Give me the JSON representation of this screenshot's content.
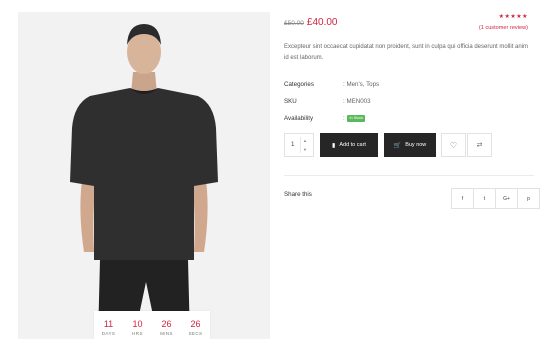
{
  "product": {
    "image_alt": "black oversized t-shirt model",
    "countdown": [
      {
        "num": "11",
        "label": "DAYS"
      },
      {
        "num": "10",
        "label": "HRS"
      },
      {
        "num": "26",
        "label": "MINS"
      },
      {
        "num": "26",
        "label": "SECS"
      }
    ]
  },
  "price": {
    "old": "£50.00",
    "new": "£40.00"
  },
  "rating": {
    "stars": "★★★★★",
    "review_text": "(1 customer review)"
  },
  "description": "Excepteur sint occaecat cupidatat non proident, sunt in culpa qui officia deserunt mollit anim id est laborum.",
  "meta": {
    "categories_label": "Categories",
    "categories_value": ": Men's, Tops",
    "sku_label": "SKU",
    "sku_value": ": MEN003",
    "availability_label": "Availability",
    "availability_prefix": ":",
    "availability_badge": "In Stock"
  },
  "cart": {
    "quantity": "1",
    "add_to_cart": "Add to cart",
    "buy_now": "Buy now"
  },
  "share": {
    "label": "Share this",
    "facebook": "f",
    "twitter": "t",
    "google": "G+",
    "pinterest": "p"
  },
  "colors": {
    "accent": "#d0243f",
    "dark_button": "#262626",
    "in_stock": "#5cb85c"
  },
  "icons": [
    "cart-icon",
    "bolt-cart-icon",
    "heart-icon",
    "compare-icon",
    "facebook-icon",
    "twitter-icon",
    "google-plus-icon",
    "pinterest-icon"
  ]
}
